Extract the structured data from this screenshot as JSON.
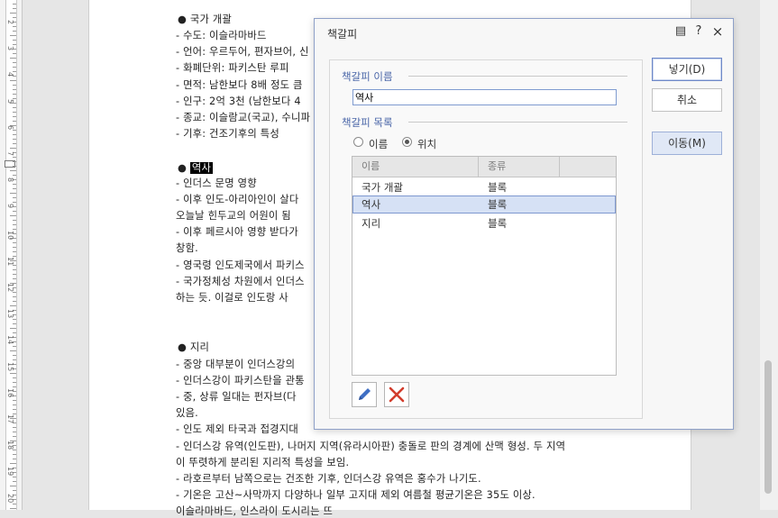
{
  "document": {
    "lines": [
      "● 국가 개괄",
      "- 수도: 이슬라마바드",
      "- 언어: 우르두어, 편자브어, 신",
      "- 화폐단위: 파키스탄 루피",
      "- 면적: 남한보다 8배 정도 큼",
      "- 인구: 2억 3천 (남한보다 4",
      "- 종교: 이슬람교(국교), 수니파",
      "- 기후: 건조기후의 특성",
      "● ",
      "- 인더스 문명 영향",
      "- 이후 인도-아리아인이 살다",
      "  오늘날 힌두교의 어원이 됨",
      "- 이후 페르시아 영향 받다가",
      "  창함.",
      "- 영국령 인도제국에서 파키스",
      "- 국가정체성 차원에서 인더스",
      "  하는 듯. 이걸로 인도랑 사",
      "● 지리",
      "- 중앙 대부분이 인더스강의",
      "- 인더스강이 파키스탄을 관통",
      "- 중, 상류 일대는 펀자브(다",
      "  있음.",
      "- 인도 제외 타국과 접경지대",
      "- 인더스강 유역(인도판), 나머지 지역(유라시아판) 충돌로 판의 경계에 산맥 형성. 두 지역",
      "  이 뚜렷하게 분리된 지리적 특성을 보임.",
      "- 라호르부터 남쪽으로는 건조한 기후, 인더스강 유역은 홍수가 나기도.",
      "- 기온은 고산~사막까지 다양하나 일부 고지대 제외 여름철 평균기온은 35도 이상.",
      "  이슬라마바드, 인스라이 도시리는 뜨"
    ],
    "highlight": "역사"
  },
  "ruler": {
    "numbers": [
      "2",
      "3",
      "4",
      "5",
      "6",
      "7",
      "8",
      "9",
      "10",
      "11",
      "12",
      "13",
      "14",
      "15",
      "16",
      "17",
      "18",
      "19",
      "20"
    ]
  },
  "dialog": {
    "title": "책갈피",
    "controls": {
      "menu": "▤",
      "help": "?",
      "close": "×"
    },
    "name_section": "책갈피 이름",
    "name_value": "역사",
    "list_section": "책갈피 목록",
    "sort_options": [
      {
        "label": "이름",
        "selected": false
      },
      {
        "label": "위치",
        "selected": true
      }
    ],
    "columns": [
      "이름",
      "종류"
    ],
    "rows": [
      {
        "name": "국가 개괄",
        "type": "블록",
        "selected": false
      },
      {
        "name": "역사",
        "type": "블록",
        "selected": true
      },
      {
        "name": "지리",
        "type": "블록",
        "selected": false
      }
    ],
    "buttons": {
      "insert": "넣기(D)",
      "cancel": "취소",
      "move": "이동(M)"
    },
    "icons": [
      "edit-icon",
      "delete-icon"
    ],
    "accent_color": "#4a66a8"
  }
}
